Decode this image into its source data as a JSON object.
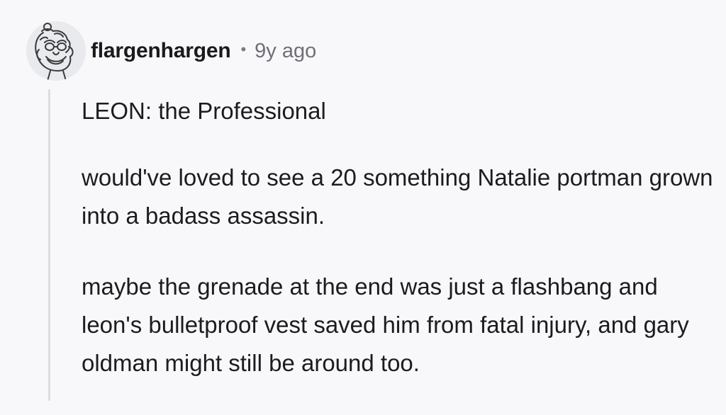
{
  "comment": {
    "author": "flargenhargen",
    "separator": "•",
    "time_ago": "9y ago",
    "avatar_icon": "user-avatar-icon",
    "paragraphs": [
      "LEON: the Professional",
      "would've loved to see a 20 something Natalie portman grown into a badass assassin.",
      "maybe the grenade at the end was just a flashbang and leon's bulletproof vest saved him from fatal injury, and gary oldman might still be around too."
    ]
  },
  "colors": {
    "background": "#f8f8fa",
    "thread_line": "#dcdce1",
    "text": "#1c1c1e",
    "meta_text": "#6f6f78"
  }
}
